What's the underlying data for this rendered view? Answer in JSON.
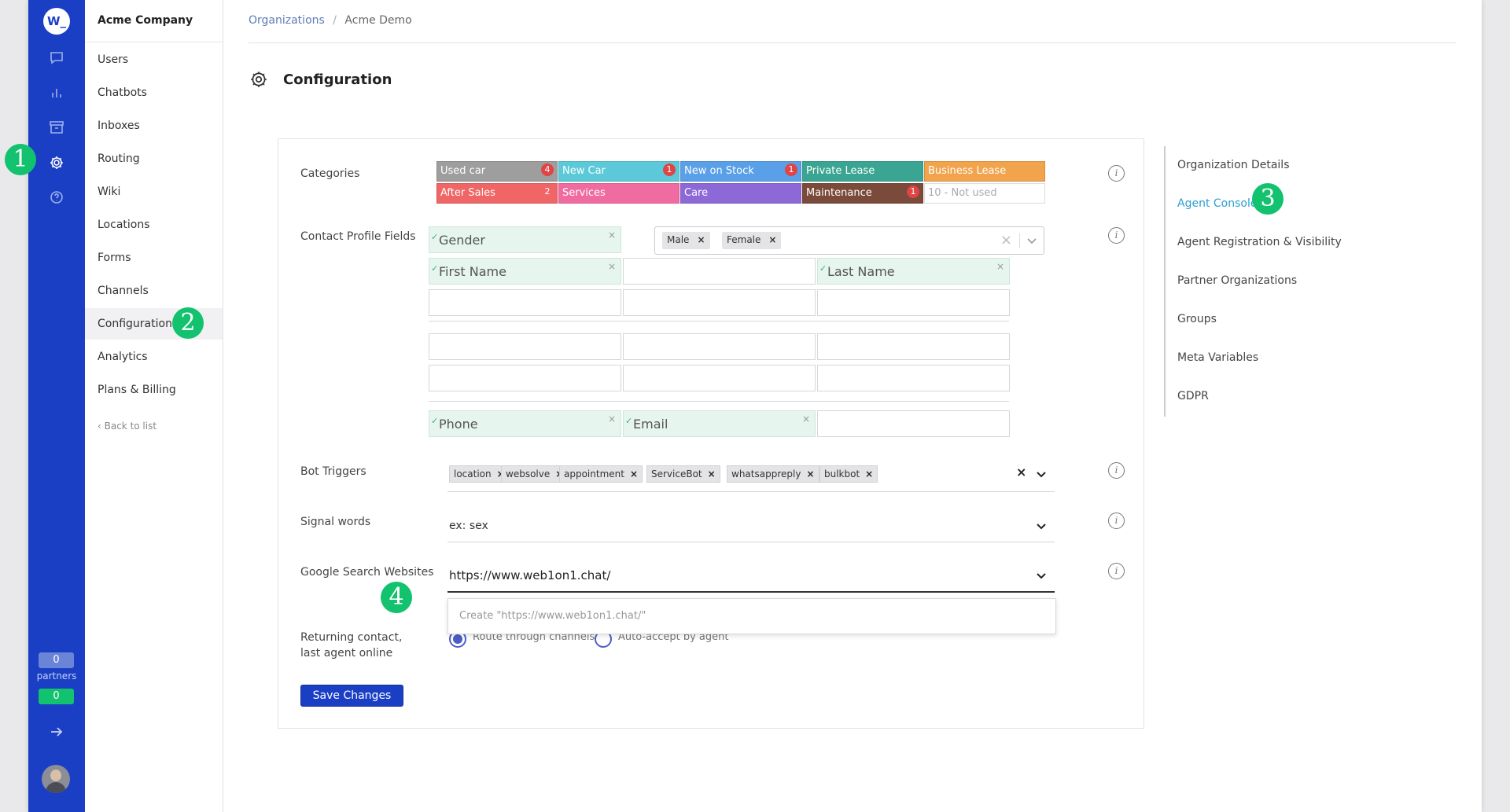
{
  "rail": {
    "logo": "W_",
    "icons": [
      "chat-icon",
      "bar-chart-icon",
      "archive-icon",
      "gear-icon",
      "help-icon"
    ],
    "partners_count": "0",
    "partners_label": "partners",
    "online_count": "0",
    "colors": {
      "rail": "#1a3fc4",
      "online": "#12c26e"
    }
  },
  "sidebar": {
    "company": "Acme Company",
    "items": [
      {
        "label": "Users"
      },
      {
        "label": "Chatbots"
      },
      {
        "label": "Inboxes"
      },
      {
        "label": "Routing"
      },
      {
        "label": "Wiki"
      },
      {
        "label": "Locations"
      },
      {
        "label": "Forms"
      },
      {
        "label": "Channels"
      },
      {
        "label": "Configuration",
        "active": true
      },
      {
        "label": "Analytics"
      },
      {
        "label": "Plans & Billing"
      }
    ],
    "back": "Back to list"
  },
  "breadcrumb": {
    "root": "Organizations",
    "separator": "/",
    "current": "Acme Demo"
  },
  "page": {
    "title": "Configuration"
  },
  "form": {
    "categories": {
      "label": "Categories",
      "items": [
        {
          "name": "Used car",
          "color": "#9e9e9e",
          "count": "4"
        },
        {
          "name": "New Car",
          "color": "#5bc9d8",
          "count": "1"
        },
        {
          "name": "New on Stock",
          "color": "#5aa0e8",
          "count": "1"
        },
        {
          "name": "Private Lease",
          "color": "#3aa592",
          "count": ""
        },
        {
          "name": "Business Lease",
          "color": "#f2a44c",
          "count": ""
        },
        {
          "name": "After Sales",
          "color": "#f06565",
          "count": "2"
        },
        {
          "name": "Services",
          "color": "#f06ba0",
          "count": ""
        },
        {
          "name": "Care",
          "color": "#8d69d8",
          "count": ""
        },
        {
          "name": "Maintenance",
          "color": "#7a4a3a",
          "count": "1"
        },
        {
          "name": "10 - Not used",
          "color": "#ffffff",
          "count": ""
        }
      ]
    },
    "profile_fields": {
      "label": "Contact Profile Fields",
      "gender": "Gender",
      "gender_options": [
        "Male",
        "Female"
      ],
      "first_name": "First Name",
      "last_name": "Last Name",
      "phone": "Phone",
      "email": "Email"
    },
    "bot_triggers": {
      "label": "Bot Triggers",
      "tags": [
        "location",
        "websolve",
        "appointment",
        "ServiceBot",
        "whatsappreply",
        "bulkbot"
      ]
    },
    "signal_words": {
      "label": "Signal words",
      "value": "ex: sex"
    },
    "google_search": {
      "label": "Google Search Websites",
      "value": "https://www.web1on1.chat/",
      "create_option": "Create \"https://www.web1on1.chat/\""
    },
    "returning_contact": {
      "label": "Returning contact, last agent online",
      "options": [
        "Route through channels",
        "Auto-accept by agent"
      ],
      "selected": "Route through channels"
    },
    "save_label": "Save Changes"
  },
  "right_nav": {
    "items": [
      {
        "label": "Organization Details"
      },
      {
        "label": "Agent Console",
        "active": true
      },
      {
        "label": "Agent Registration & Visibility"
      },
      {
        "label": "Partner Organizations"
      },
      {
        "label": "Groups"
      },
      {
        "label": "Meta Variables"
      },
      {
        "label": "GDPR"
      }
    ]
  },
  "steps": [
    "1",
    "2",
    "3",
    "4"
  ]
}
